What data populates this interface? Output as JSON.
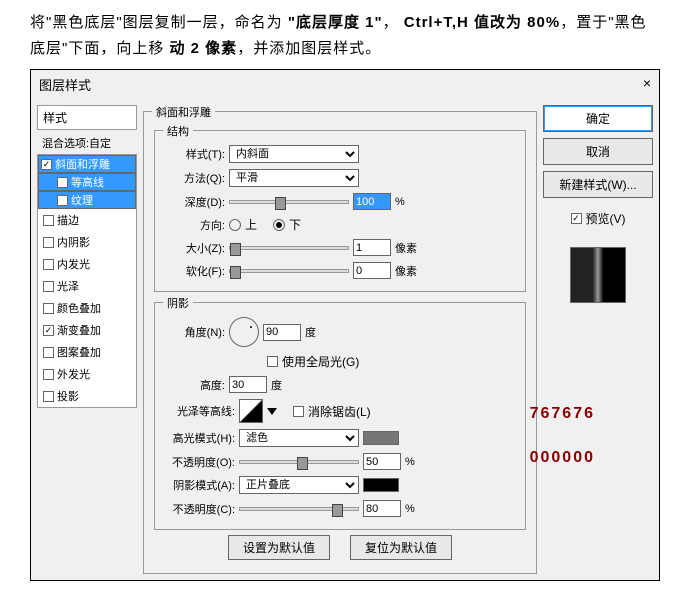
{
  "instruction": {
    "t1": "将\"黑色底层\"图层复制一层，命名为",
    "b1": "\"底层厚度 1\"",
    "t2": "，",
    "b2": "Ctrl+T,H 值改为 80%",
    "t3": "，置于\"黑色底层\"下面，向上移",
    "b3": "动 2 像素",
    "t4": "，并添加图层样式。"
  },
  "dialog": {
    "title": "图层样式",
    "close": "×"
  },
  "styles": {
    "header": "样式",
    "blend": "混合选项:自定",
    "items": [
      {
        "label": "斜面和浮雕",
        "checked": true,
        "sel": true
      },
      {
        "label": "等高线",
        "checked": false,
        "sub": true,
        "sel": true
      },
      {
        "label": "纹理",
        "checked": false,
        "sub": true,
        "sel": true
      },
      {
        "label": "描边",
        "checked": false
      },
      {
        "label": "内阴影",
        "checked": false
      },
      {
        "label": "内发光",
        "checked": false
      },
      {
        "label": "光泽",
        "checked": false
      },
      {
        "label": "颜色叠加",
        "checked": false
      },
      {
        "label": "渐变叠加",
        "checked": true
      },
      {
        "label": "图案叠加",
        "checked": false
      },
      {
        "label": "外发光",
        "checked": false
      },
      {
        "label": "投影",
        "checked": false
      }
    ]
  },
  "bevel": {
    "group": "斜面和浮雕",
    "struct": "结构",
    "style": {
      "label": "样式(T):",
      "value": "内斜面"
    },
    "technique": {
      "label": "方法(Q):",
      "value": "平滑"
    },
    "depth": {
      "label": "深度(D):",
      "value": "100",
      "unit": "%"
    },
    "direction": {
      "label": "方向:",
      "up": "上",
      "down": "下"
    },
    "size": {
      "label": "大小(Z):",
      "value": "1",
      "unit": "像素"
    },
    "soften": {
      "label": "软化(F):",
      "value": "0",
      "unit": "像素"
    }
  },
  "shading": {
    "group": "阴影",
    "angle": {
      "label": "角度(N):",
      "value": "90",
      "unit": "度"
    },
    "global": "使用全局光(G)",
    "altitude": {
      "label": "高度:",
      "value": "30",
      "unit": "度"
    },
    "gloss": {
      "label": "光泽等高线:",
      "anti": "消除锯齿(L)"
    },
    "highlight": {
      "label": "高光模式(H):",
      "value": "滤色",
      "color": "#767676"
    },
    "hopacity": {
      "label": "不透明度(O):",
      "value": "50",
      "unit": "%"
    },
    "shadow": {
      "label": "阴影模式(A):",
      "value": "正片叠底",
      "color": "#000000"
    },
    "sopacity": {
      "label": "不透明度(C):",
      "value": "80",
      "unit": "%"
    }
  },
  "notes": {
    "hl": "767676",
    "sh": "000000"
  },
  "buttons": {
    "ok": "确定",
    "cancel": "取消",
    "newstyle": "新建样式(W)...",
    "preview": "预览(V)",
    "setdef": "设置为默认值",
    "resetdef": "复位为默认值"
  }
}
